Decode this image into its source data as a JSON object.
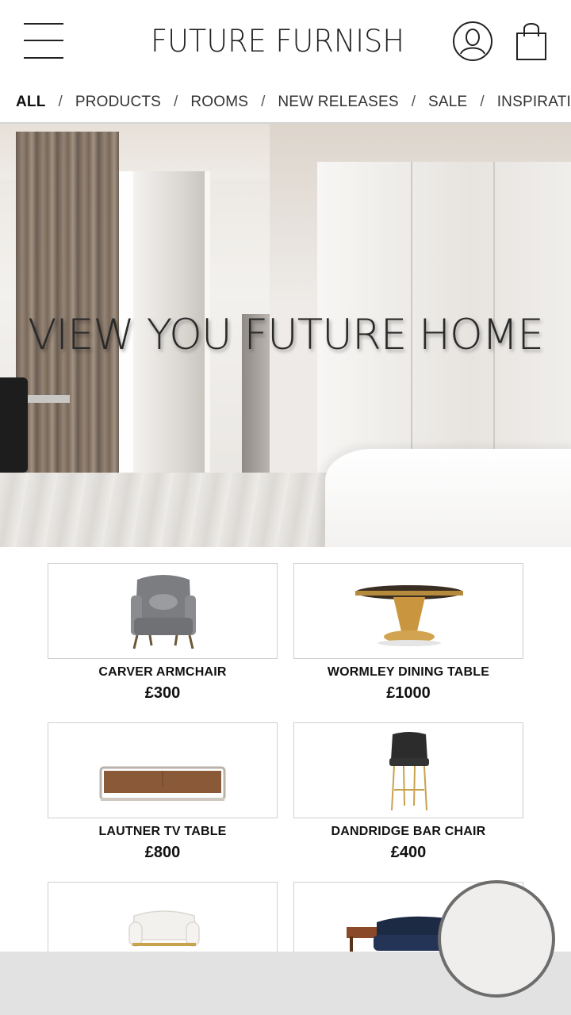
{
  "header": {
    "brand": "FUTURE FURNISH",
    "icons": {
      "menu": "hamburger-menu-icon",
      "account": "user-account-icon",
      "cart": "shopping-bag-icon"
    }
  },
  "nav": {
    "items": [
      {
        "label": "ALL",
        "active": true
      },
      {
        "label": "PRODUCTS",
        "active": false
      },
      {
        "label": "ROOMS",
        "active": false
      },
      {
        "label": "NEW RELEASES",
        "active": false
      },
      {
        "label": "SALE",
        "active": false
      },
      {
        "label": "INSPIRATION",
        "active": false
      }
    ],
    "separator": "/"
  },
  "hero": {
    "title": "VIEW YOU FUTURE HOME"
  },
  "products": [
    {
      "name": "CARVER ARMCHAIR",
      "price": "£300"
    },
    {
      "name": "WORMLEY DINING TABLE",
      "price": "£1000"
    },
    {
      "name": "LAUTNER TV TABLE",
      "price": "£800"
    },
    {
      "name": "DANDRIDGE BAR CHAIR",
      "price": "£400"
    },
    {
      "name": "",
      "price": ""
    },
    {
      "name": "",
      "price": ""
    }
  ],
  "colors": {
    "text": "#222222",
    "border": "#cfcfcf",
    "bottom_bar": "#e2e2e2",
    "fab_ring": "#6d6d6d"
  }
}
